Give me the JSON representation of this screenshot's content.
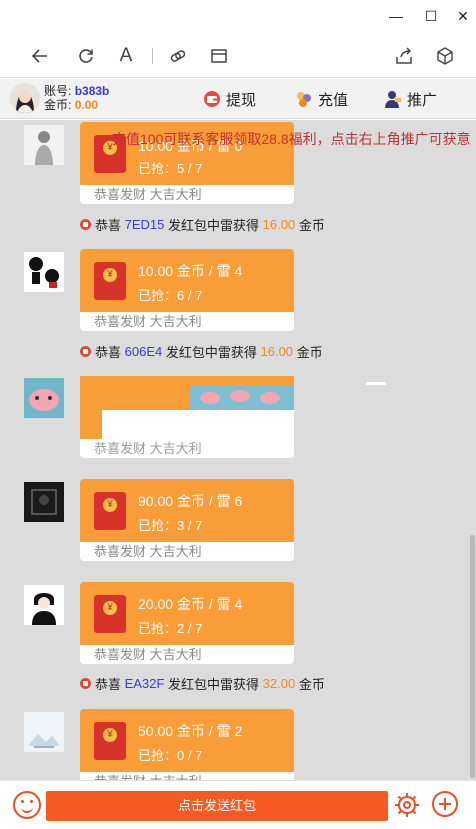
{
  "window": {
    "minimize_glyph": "—",
    "maximize_glyph": "☐",
    "close_glyph": "✕"
  },
  "browser_toolbar": {
    "text_icon_glyph": "A"
  },
  "header": {
    "account_label": "账号:",
    "account_value": "b383b",
    "coins_label": "金币:",
    "coins_value": "0.00",
    "withdraw_label": "提现",
    "recharge_label": "充值",
    "promote_label": "推广"
  },
  "marquee": "充值100可联系客服领取28.8福利，点击右上角推广可获意",
  "messages": [
    {
      "amount": "10.00 金币 / 雷 0",
      "grabbed": "已抢：5 / 7",
      "blessing": "恭喜发财 大吉大利"
    },
    {
      "amount": "10.00 金币 / 雷 4",
      "grabbed": "已抢：6 / 7",
      "blessing": "恭喜发财 大吉大利"
    },
    {
      "amount": "",
      "grabbed": "",
      "blessing": "恭喜发财 大吉大利"
    },
    {
      "amount": "90.00 金币 / 雷 6",
      "grabbed": "已抢：3 / 7",
      "blessing": "恭喜发财 大吉大利"
    },
    {
      "amount": "20.00 金币 / 雷 4",
      "grabbed": "已抢：2 / 7",
      "blessing": "恭喜发财 大吉大利"
    },
    {
      "amount": "50.00 金币 / 雷 2",
      "grabbed": "已抢：0 / 7",
      "blessing": "恭喜发财 大吉大利"
    }
  ],
  "notices": [
    {
      "prefix": "恭喜",
      "code": "7ED15",
      "middle": "发红包中雷获得",
      "amount": "16.00",
      "suffix": "金币"
    },
    {
      "prefix": "恭喜",
      "code": "606E4",
      "middle": "发红包中雷获得",
      "amount": "16.00",
      "suffix": "金币"
    },
    {
      "prefix": "恭喜",
      "code": "EA32F",
      "middle": "发红包中雷获得",
      "amount": "32.00",
      "suffix": "金币"
    }
  ],
  "bottom": {
    "send_label": "点击发送红包"
  },
  "colors": {
    "accent": "#f45a22",
    "bubble": "#f99d38",
    "code": "#3a3ad0",
    "amount": "#f08a1e"
  }
}
